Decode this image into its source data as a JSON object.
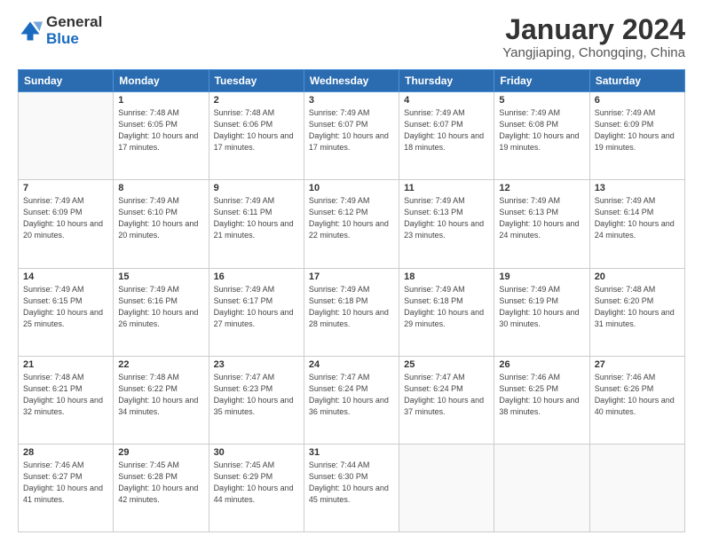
{
  "header": {
    "logo_general": "General",
    "logo_blue": "Blue",
    "title": "January 2024",
    "subtitle": "Yangjiaping, Chongqing, China"
  },
  "days_of_week": [
    "Sunday",
    "Monday",
    "Tuesday",
    "Wednesday",
    "Thursday",
    "Friday",
    "Saturday"
  ],
  "weeks": [
    [
      {
        "num": "",
        "rise": "",
        "set": "",
        "daylight": ""
      },
      {
        "num": "1",
        "rise": "Sunrise: 7:48 AM",
        "set": "Sunset: 6:05 PM",
        "daylight": "Daylight: 10 hours and 17 minutes."
      },
      {
        "num": "2",
        "rise": "Sunrise: 7:48 AM",
        "set": "Sunset: 6:06 PM",
        "daylight": "Daylight: 10 hours and 17 minutes."
      },
      {
        "num": "3",
        "rise": "Sunrise: 7:49 AM",
        "set": "Sunset: 6:07 PM",
        "daylight": "Daylight: 10 hours and 17 minutes."
      },
      {
        "num": "4",
        "rise": "Sunrise: 7:49 AM",
        "set": "Sunset: 6:07 PM",
        "daylight": "Daylight: 10 hours and 18 minutes."
      },
      {
        "num": "5",
        "rise": "Sunrise: 7:49 AM",
        "set": "Sunset: 6:08 PM",
        "daylight": "Daylight: 10 hours and 19 minutes."
      },
      {
        "num": "6",
        "rise": "Sunrise: 7:49 AM",
        "set": "Sunset: 6:09 PM",
        "daylight": "Daylight: 10 hours and 19 minutes."
      }
    ],
    [
      {
        "num": "7",
        "rise": "Sunrise: 7:49 AM",
        "set": "Sunset: 6:09 PM",
        "daylight": "Daylight: 10 hours and 20 minutes."
      },
      {
        "num": "8",
        "rise": "Sunrise: 7:49 AM",
        "set": "Sunset: 6:10 PM",
        "daylight": "Daylight: 10 hours and 20 minutes."
      },
      {
        "num": "9",
        "rise": "Sunrise: 7:49 AM",
        "set": "Sunset: 6:11 PM",
        "daylight": "Daylight: 10 hours and 21 minutes."
      },
      {
        "num": "10",
        "rise": "Sunrise: 7:49 AM",
        "set": "Sunset: 6:12 PM",
        "daylight": "Daylight: 10 hours and 22 minutes."
      },
      {
        "num": "11",
        "rise": "Sunrise: 7:49 AM",
        "set": "Sunset: 6:13 PM",
        "daylight": "Daylight: 10 hours and 23 minutes."
      },
      {
        "num": "12",
        "rise": "Sunrise: 7:49 AM",
        "set": "Sunset: 6:13 PM",
        "daylight": "Daylight: 10 hours and 24 minutes."
      },
      {
        "num": "13",
        "rise": "Sunrise: 7:49 AM",
        "set": "Sunset: 6:14 PM",
        "daylight": "Daylight: 10 hours and 24 minutes."
      }
    ],
    [
      {
        "num": "14",
        "rise": "Sunrise: 7:49 AM",
        "set": "Sunset: 6:15 PM",
        "daylight": "Daylight: 10 hours and 25 minutes."
      },
      {
        "num": "15",
        "rise": "Sunrise: 7:49 AM",
        "set": "Sunset: 6:16 PM",
        "daylight": "Daylight: 10 hours and 26 minutes."
      },
      {
        "num": "16",
        "rise": "Sunrise: 7:49 AM",
        "set": "Sunset: 6:17 PM",
        "daylight": "Daylight: 10 hours and 27 minutes."
      },
      {
        "num": "17",
        "rise": "Sunrise: 7:49 AM",
        "set": "Sunset: 6:18 PM",
        "daylight": "Daylight: 10 hours and 28 minutes."
      },
      {
        "num": "18",
        "rise": "Sunrise: 7:49 AM",
        "set": "Sunset: 6:18 PM",
        "daylight": "Daylight: 10 hours and 29 minutes."
      },
      {
        "num": "19",
        "rise": "Sunrise: 7:49 AM",
        "set": "Sunset: 6:19 PM",
        "daylight": "Daylight: 10 hours and 30 minutes."
      },
      {
        "num": "20",
        "rise": "Sunrise: 7:48 AM",
        "set": "Sunset: 6:20 PM",
        "daylight": "Daylight: 10 hours and 31 minutes."
      }
    ],
    [
      {
        "num": "21",
        "rise": "Sunrise: 7:48 AM",
        "set": "Sunset: 6:21 PM",
        "daylight": "Daylight: 10 hours and 32 minutes."
      },
      {
        "num": "22",
        "rise": "Sunrise: 7:48 AM",
        "set": "Sunset: 6:22 PM",
        "daylight": "Daylight: 10 hours and 34 minutes."
      },
      {
        "num": "23",
        "rise": "Sunrise: 7:47 AM",
        "set": "Sunset: 6:23 PM",
        "daylight": "Daylight: 10 hours and 35 minutes."
      },
      {
        "num": "24",
        "rise": "Sunrise: 7:47 AM",
        "set": "Sunset: 6:24 PM",
        "daylight": "Daylight: 10 hours and 36 minutes."
      },
      {
        "num": "25",
        "rise": "Sunrise: 7:47 AM",
        "set": "Sunset: 6:24 PM",
        "daylight": "Daylight: 10 hours and 37 minutes."
      },
      {
        "num": "26",
        "rise": "Sunrise: 7:46 AM",
        "set": "Sunset: 6:25 PM",
        "daylight": "Daylight: 10 hours and 38 minutes."
      },
      {
        "num": "27",
        "rise": "Sunrise: 7:46 AM",
        "set": "Sunset: 6:26 PM",
        "daylight": "Daylight: 10 hours and 40 minutes."
      }
    ],
    [
      {
        "num": "28",
        "rise": "Sunrise: 7:46 AM",
        "set": "Sunset: 6:27 PM",
        "daylight": "Daylight: 10 hours and 41 minutes."
      },
      {
        "num": "29",
        "rise": "Sunrise: 7:45 AM",
        "set": "Sunset: 6:28 PM",
        "daylight": "Daylight: 10 hours and 42 minutes."
      },
      {
        "num": "30",
        "rise": "Sunrise: 7:45 AM",
        "set": "Sunset: 6:29 PM",
        "daylight": "Daylight: 10 hours and 44 minutes."
      },
      {
        "num": "31",
        "rise": "Sunrise: 7:44 AM",
        "set": "Sunset: 6:30 PM",
        "daylight": "Daylight: 10 hours and 45 minutes."
      },
      {
        "num": "",
        "rise": "",
        "set": "",
        "daylight": ""
      },
      {
        "num": "",
        "rise": "",
        "set": "",
        "daylight": ""
      },
      {
        "num": "",
        "rise": "",
        "set": "",
        "daylight": ""
      }
    ]
  ]
}
